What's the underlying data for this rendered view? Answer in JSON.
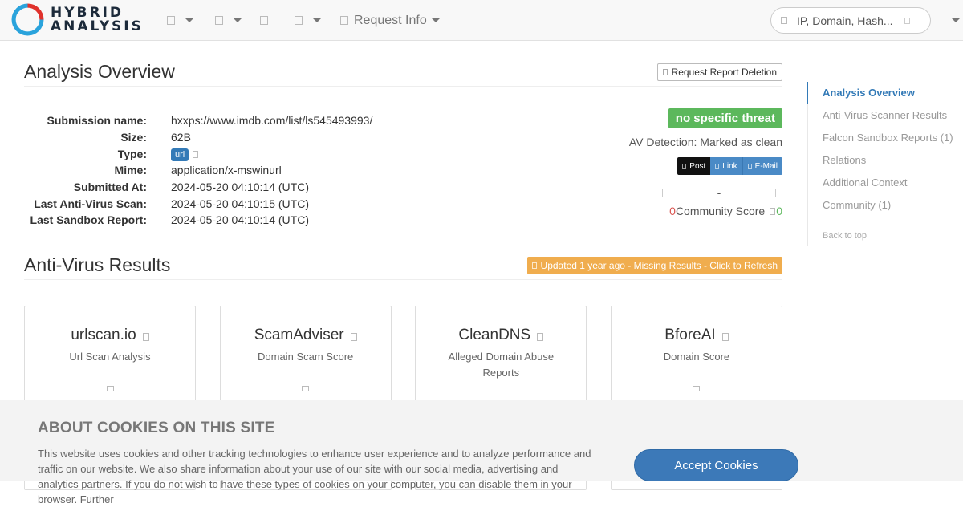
{
  "nav": {
    "logo_line1": "HYBRID",
    "logo_line2": "ANALYSIS",
    "request_info": "Request Info",
    "search_placeholder": "IP, Domain, Hash..."
  },
  "overview": {
    "title": "Analysis Overview",
    "delete_button": "Request Report Deletion",
    "fields": [
      {
        "label": "Submission name:",
        "value": "hxxps://www.imdb.com/list/ls545493993/"
      },
      {
        "label": "Size:",
        "value": "62B"
      },
      {
        "label": "Type:",
        "value": "url"
      },
      {
        "label": "Mime:",
        "value": "application/x-mswinurl"
      },
      {
        "label": "Submitted At:",
        "value": "2024-05-20 04:10:14 (UTC)"
      },
      {
        "label": "Last Anti-Virus Scan:",
        "value": "2024-05-20 04:10:15 (UTC)"
      },
      {
        "label": "Last Sandbox Report:",
        "value": "2024-05-20 04:10:14 (UTC)"
      }
    ],
    "threat_badge": "no specific threat",
    "av_detection": "AV Detection: Marked as clean",
    "share": {
      "post": "Post",
      "link": "Link",
      "email": "E-Mail"
    },
    "vote_dash": "-",
    "score_negative": "0",
    "community_score_label": "Community Score",
    "score_positive": "0"
  },
  "av_results": {
    "title": "Anti-Virus Results",
    "refresh_button": "Updated 1 year ago - Missing Results - Click to Refresh",
    "cards": [
      {
        "name": "urlscan.io",
        "desc": "Url Scan Analysis"
      },
      {
        "name": "ScamAdviser",
        "desc": "Domain Scam Score"
      },
      {
        "name": "CleanDNS",
        "desc": "Alleged Domain Abuse Reports"
      },
      {
        "name": "BforeAI",
        "desc": "Domain Score"
      }
    ]
  },
  "sidenav": {
    "items": [
      "Analysis Overview",
      "Anti-Virus Scanner Results",
      "Falcon Sandbox Reports (1)",
      "Relations",
      "Additional Context",
      "Community (1)"
    ],
    "back_to_top": "Back to top"
  },
  "cookie": {
    "title": "ABOUT COOKIES ON THIS SITE",
    "text": "This website uses cookies and other tracking technologies to enhance user experience and to analyze performance and traffic on our website. We also share information about your use of our site with our social media, advertising and analytics partners. If you do not wish to have these types of cookies on your computer, you can disable them in your browser. Further",
    "accept": "Accept Cookies"
  },
  "colors": {
    "accent": "#337ab7",
    "threat_green": "#5cb85c",
    "warning_orange": "#f0ad4e",
    "logo_blue": "#2aa3dc",
    "logo_red": "#e0322c"
  }
}
